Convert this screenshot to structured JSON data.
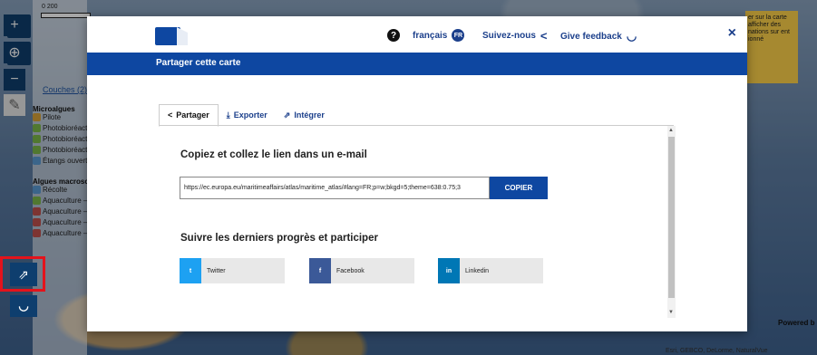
{
  "map": {
    "scale_label": "0      200",
    "layers_link": "Couches (2)",
    "groups": [
      {
        "title": "Microalgues",
        "items": [
          "Pilote",
          "Photobioréacte",
          "Photobioréacte",
          "Photobioréacte",
          "Étangs ouverts"
        ]
      },
      {
        "title": "Algues macrosc",
        "items": [
          "Récolte",
          "Aquaculture —",
          "Aquaculture —",
          "Aquaculture —",
          "Aquaculture —"
        ]
      }
    ],
    "right_info": "er sur la carte afficher des nations sur ent ionné",
    "powered_by": "Powered b",
    "attribution": "Esri, GEBCO, DeLorme, NaturalVue"
  },
  "modal": {
    "links": {
      "language": "français",
      "language_badge": "FR",
      "follow": "Suivez-nous",
      "feedback": "Give feedback"
    },
    "close": "×",
    "title": "Partager cette carte",
    "tabs": [
      "Partager",
      "Exporter",
      "Intégrer"
    ],
    "copy_section": {
      "title": "Copiez et collez le lien dans un e-mail",
      "url": "https://ec.europa.eu/maritimeaffairs/atlas/maritime_atlas/#lang=FR;p=w;bkgd=5;theme=638:0.75;3",
      "copy_button": "COPIER"
    },
    "follow_section": {
      "title": "Suivre les derniers progrès et participer",
      "twitter": "Twitter",
      "facebook": "Facebook",
      "linkedin": "Linkedin"
    }
  },
  "colors": {
    "eu_blue": "#0e47a1",
    "highlight": "#e4131b",
    "twitter": "#1da1f2",
    "facebook": "#3b5998",
    "linkedin": "#0077b5"
  }
}
